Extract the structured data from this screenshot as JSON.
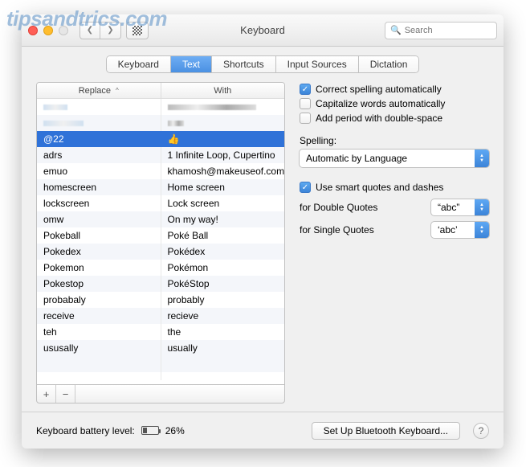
{
  "watermark": "tipsandtrics.com",
  "window": {
    "title": "Keyboard"
  },
  "search": {
    "placeholder": "Search"
  },
  "tabs": [
    "Keyboard",
    "Text",
    "Shortcuts",
    "Input Sources",
    "Dictation"
  ],
  "active_tab": 1,
  "table": {
    "columns": [
      "Replace",
      "With"
    ],
    "rows": [
      {
        "replace": "@22",
        "with": "👍",
        "selected": true
      },
      {
        "replace": "adrs",
        "with": "1 Infinite Loop, Cupertino"
      },
      {
        "replace": "emuo",
        "with": "khamosh@makeuseof.com"
      },
      {
        "replace": "homescreen",
        "with": "Home screen"
      },
      {
        "replace": "lockscreen",
        "with": "Lock screen"
      },
      {
        "replace": "omw",
        "with": "On my way!"
      },
      {
        "replace": "Pokeball",
        "with": "Poké Ball"
      },
      {
        "replace": "Pokedex",
        "with": "Pokédex"
      },
      {
        "replace": "Pokemon",
        "with": "Pokémon"
      },
      {
        "replace": "Pokestop",
        "with": "PokéStop"
      },
      {
        "replace": "probabaly",
        "with": "probably"
      },
      {
        "replace": "receive",
        "with": "recieve"
      },
      {
        "replace": "teh",
        "with": "the"
      },
      {
        "replace": "ususally",
        "with": "usually"
      }
    ]
  },
  "options": {
    "correct_spelling": {
      "label": "Correct spelling automatically",
      "checked": true
    },
    "capitalize": {
      "label": "Capitalize words automatically",
      "checked": false
    },
    "period": {
      "label": "Add period with double-space",
      "checked": false
    },
    "spelling_label": "Spelling:",
    "spelling_value": "Automatic by Language",
    "smart_quotes": {
      "label": "Use smart quotes and dashes",
      "checked": true
    },
    "double_label": "for Double Quotes",
    "double_value": "“abc”",
    "single_label": "for Single Quotes",
    "single_value": "‘abc’"
  },
  "footer": {
    "battery_label": "Keyboard battery level:",
    "battery_pct": "26%",
    "bluetooth_btn": "Set Up Bluetooth Keyboard..."
  },
  "glyphs": {
    "plus": "+",
    "minus": "−",
    "back": "❮",
    "fwd": "❯",
    "help": "?",
    "check": "✓",
    "up": "▲",
    "down": "▼",
    "caret": "^",
    "search": "🔍"
  }
}
